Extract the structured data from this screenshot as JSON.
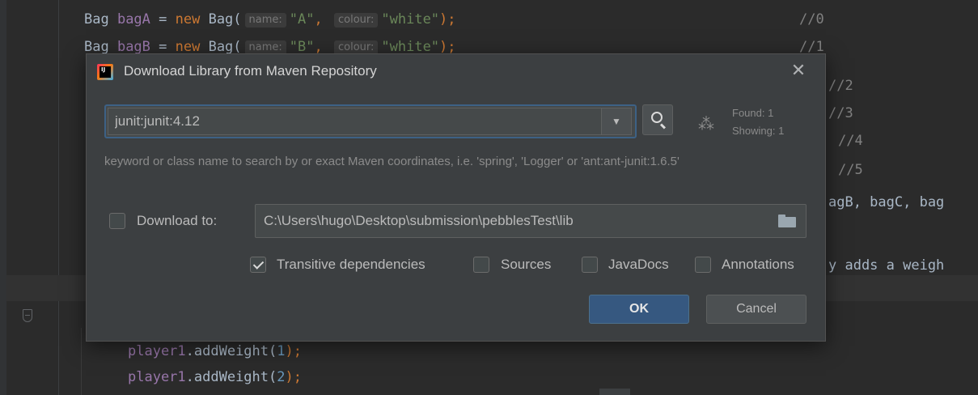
{
  "editor": {
    "lines": [
      {
        "tokens": [
          {
            "text": "Bag ",
            "cls": ""
          },
          {
            "text": "bagA",
            "cls": "var"
          },
          {
            "text": " = ",
            "cls": ""
          },
          {
            "text": "new",
            "cls": "kw"
          },
          {
            "text": " Bag(",
            "cls": ""
          },
          {
            "hint": "name:"
          },
          {
            "text": "\"A\"",
            "cls": "str"
          },
          {
            "text": ", ",
            "cls": "kw"
          },
          {
            "hint": "colour:"
          },
          {
            "text": "\"white\"",
            "cls": "str"
          },
          {
            "text": ");",
            "cls": "kw"
          }
        ]
      },
      {
        "tokens": [
          {
            "text": "Bag ",
            "cls": ""
          },
          {
            "text": "bagB",
            "cls": "var"
          },
          {
            "text": " = ",
            "cls": ""
          },
          {
            "text": "new",
            "cls": "kw"
          },
          {
            "text": " Bag(",
            "cls": ""
          },
          {
            "hint": "name:"
          },
          {
            "text": "\"B\"",
            "cls": "str"
          },
          {
            "text": ", ",
            "cls": "kw"
          },
          {
            "hint": "colour:"
          },
          {
            "text": "\"white\"",
            "cls": "str"
          },
          {
            "text": ");",
            "cls": "kw"
          }
        ]
      }
    ],
    "comments": [
      "//0",
      "//1",
      "//2",
      "//3",
      "//4",
      "//5"
    ],
    "right_fragment_1": "agB, bagC, bag",
    "right_fragment_2": "y adds a weigh",
    "bottom_lines": [
      {
        "obj": "player1",
        "call": ".addWeight(",
        "arg": "1",
        "end": ");"
      },
      {
        "obj": "player1",
        "call": ".addWeight(",
        "arg": "2",
        "end": ");"
      }
    ]
  },
  "dialog": {
    "title": "Download Library from Maven Repository",
    "close_icon": "close-icon",
    "search": {
      "value": "junit:junit:4.12",
      "placeholder": "",
      "found": "Found: 1",
      "showing": "Showing: 1"
    },
    "hint": "keyword or class name to search by or exact Maven coordinates, i.e. 'spring', 'Logger' or 'ant:ant-junit:1.6.5'",
    "download_to": {
      "label": "Download to:",
      "checked": false,
      "path": "C:\\Users\\hugo\\Desktop\\submission\\pebblesTest\\lib"
    },
    "options": [
      {
        "label": "Transitive dependencies",
        "checked": true
      },
      {
        "label": "Sources",
        "checked": false
      },
      {
        "label": "JavaDocs",
        "checked": false
      },
      {
        "label": "Annotations",
        "checked": false
      }
    ],
    "ok_label": "OK",
    "cancel_label": "Cancel"
  },
  "colors": {
    "editor_bg": "#2b2b2b",
    "dialog_bg": "#3c3f41",
    "ok_button": "#365880",
    "focus_border": "#3d6185"
  }
}
